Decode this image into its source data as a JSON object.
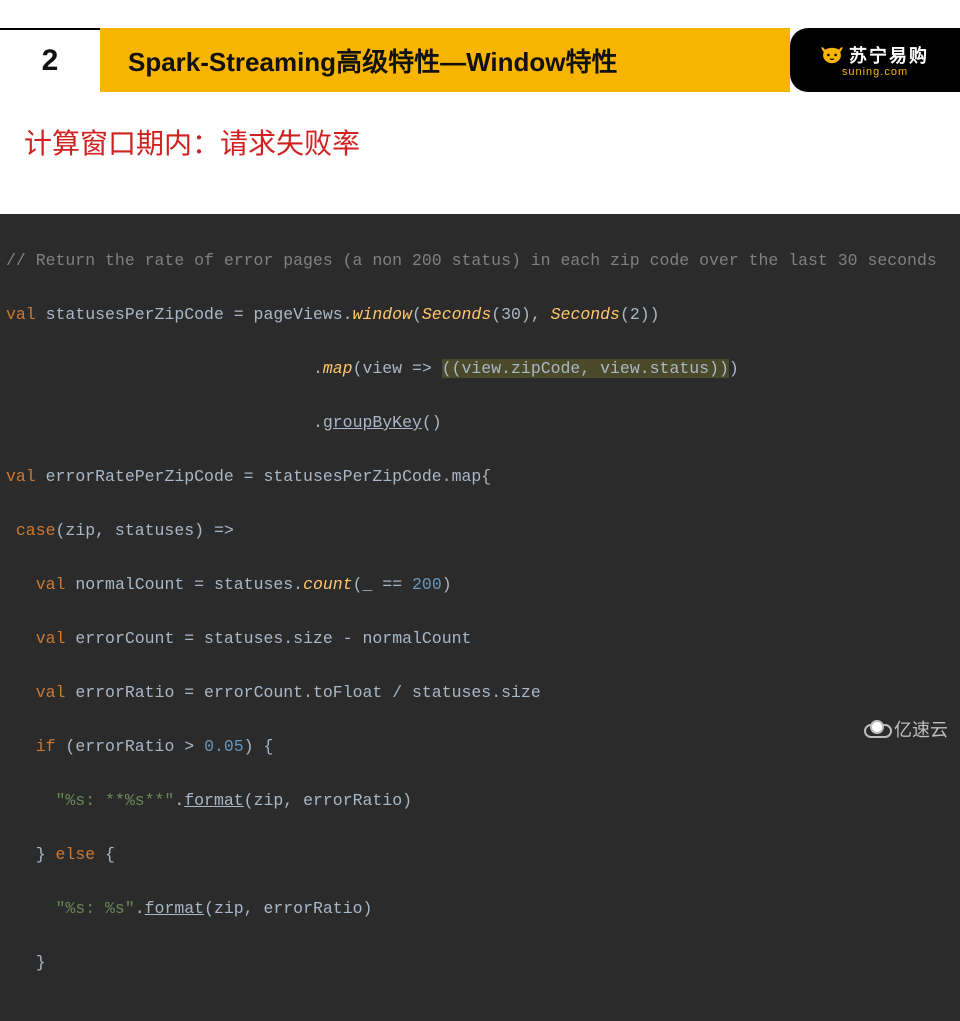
{
  "header": {
    "number": "2",
    "title": "Spark-Streaming高级特性—Window特性",
    "brand_main": "苏宁易购",
    "brand_sub": "suning.com"
  },
  "section_title": "计算窗口期内：请求失败率",
  "code": {
    "l1_comment": "// Return the rate of error pages (a non 200 status) in each zip code over the last 30 seconds",
    "l2_kw": "val",
    "l2_rest1": " statusesPerZipCode = pageViews.",
    "l2_win": "window",
    "l2_rest2": "(",
    "l2_sec1": "Seconds",
    "l2_rest3": "(30), ",
    "l2_sec2": "Seconds",
    "l2_rest4": "(2))",
    "l3_pad": "                               .",
    "l3_map": "map",
    "l3_rest1": "(view => ",
    "l3_hl": "((view.zipCode, view.status))",
    "l3_rest2": ")",
    "l4_pad": "                               .",
    "l4_gbk": "groupByKey",
    "l4_rest": "()",
    "l5_kw": "val",
    "l5_rest": " errorRatePerZipCode = statusesPerZipCode.map{",
    "l6_kw": "case",
    "l6_rest": "(zip, statuses) =>",
    "l7_kw": "val",
    "l7_rest1": " normalCount = statuses.",
    "l7_cnt": "count",
    "l7_rest2": "(_ == ",
    "l7_num": "200",
    "l7_rest3": ")",
    "l8_kw": "val",
    "l8_rest": " errorCount = statuses.size - normalCount",
    "l9_kw": "val",
    "l9_rest": " errorRatio = errorCount.toFloat / statuses.size",
    "l10_kw": "if",
    "l10_rest1": " (errorRatio > ",
    "l10_num": "0.05",
    "l10_rest2": ") {",
    "l11_str": "\"%s: **%s**\"",
    "l11_dot": ".",
    "l11_fmt": "format",
    "l11_rest": "(zip, errorRatio)",
    "l12_rest1": "} ",
    "l12_kw": "else",
    "l12_rest2": " {",
    "l13_str": "\"%s: %s\"",
    "l13_dot": ".",
    "l13_fmt": "format",
    "l13_rest": "(zip, errorRatio)",
    "l14": "}"
  },
  "watermark": "亿速云"
}
